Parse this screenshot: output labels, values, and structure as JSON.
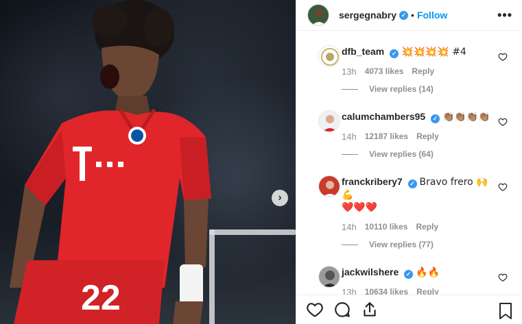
{
  "post": {
    "username": "sergegnabry",
    "follow_label": "Follow",
    "more_label": "•••",
    "player_number": "22"
  },
  "colors": {
    "jersey_red": "#e0262a",
    "link_blue": "#0095f6",
    "verified_blue": "#3897f0",
    "muted_gray": "#8e8e8e"
  },
  "comments": [
    {
      "username": "dfb_team",
      "text": "💥💥💥💥 #4",
      "time": "13h",
      "likes": "4073 likes",
      "reply": "Reply",
      "view_replies": "View replies (14)"
    },
    {
      "username": "calumchambers95",
      "text": "👏🏽👏🏽👏🏽👏🏽",
      "time": "14h",
      "likes": "12187 likes",
      "reply": "Reply",
      "view_replies": "View replies (64)"
    },
    {
      "username": "franckribery7",
      "text": "Bravo frero 🙌💪",
      "text2": "❤️❤️❤️",
      "time": "14h",
      "likes": "10110 likes",
      "reply": "Reply",
      "view_replies": "View replies (77)"
    },
    {
      "username": "jackwilshere",
      "text": "🔥🔥",
      "time": "13h",
      "likes": "10634 likes",
      "reply": "Reply"
    }
  ],
  "icons": {
    "like": "heart-icon",
    "comment": "comment-icon",
    "share": "share-icon",
    "save": "bookmark-icon",
    "next": "chevron-right-icon"
  }
}
